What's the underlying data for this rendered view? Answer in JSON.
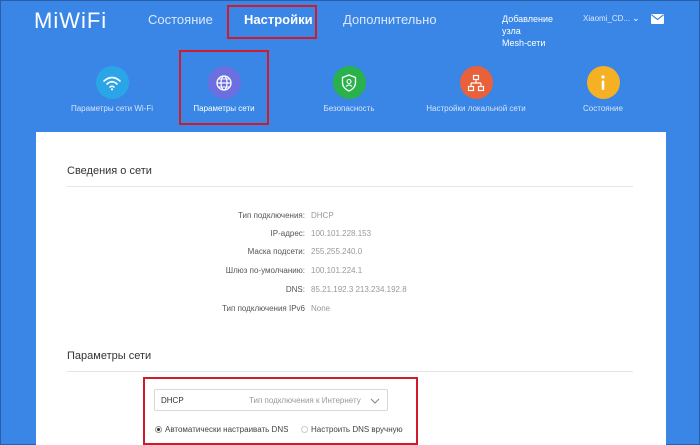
{
  "brand": {
    "logo": "MiWiFi"
  },
  "nav": {
    "tabs": [
      {
        "label": "Состояние"
      },
      {
        "label": "Настройки"
      },
      {
        "label": "Дополнительно"
      }
    ],
    "mesh_line1": "Добавление узла",
    "mesh_line2": "Mesh-сети",
    "device": "Xiaomi_CD..."
  },
  "features": [
    {
      "label": "Параметры сети Wi-Fi",
      "icon": "wifi-icon",
      "color": "#2aa6e8"
    },
    {
      "label": "Параметры сети",
      "icon": "globe-icon",
      "color": "#6b6fe0"
    },
    {
      "label": "Безопасность",
      "icon": "shield-icon",
      "color": "#29b24b"
    },
    {
      "label": "Настройки локальной сети",
      "icon": "lan-icon",
      "color": "#e8613a"
    },
    {
      "label": "Состояние",
      "icon": "info-icon",
      "color": "#f5b023"
    }
  ],
  "network_info": {
    "title": "Сведения о сети",
    "rows": [
      {
        "key": "Тип подключения:",
        "value": "DHCP"
      },
      {
        "key": "IP-адрес:",
        "value": "100.101.228.153"
      },
      {
        "key": "Маска подсети:",
        "value": "255.255.240.0"
      },
      {
        "key": "Шлюз по-умолчанию:",
        "value": "100.101.224.1"
      },
      {
        "key": "DNS:",
        "value": "85.21.192.3 213.234.192.8"
      },
      {
        "key": "Тип подключения IPv6",
        "value": "None"
      }
    ]
  },
  "network_params": {
    "title": "Параметры сети",
    "connection_value": "DHCP",
    "connection_placeholder": "Тип подключения к Интернету",
    "dns_auto": "Автоматически настраивать DNS",
    "dns_manual": "Настроить DNS вручную"
  },
  "colors": {
    "background": "#3a86e6",
    "highlight": "#d11a2a"
  }
}
